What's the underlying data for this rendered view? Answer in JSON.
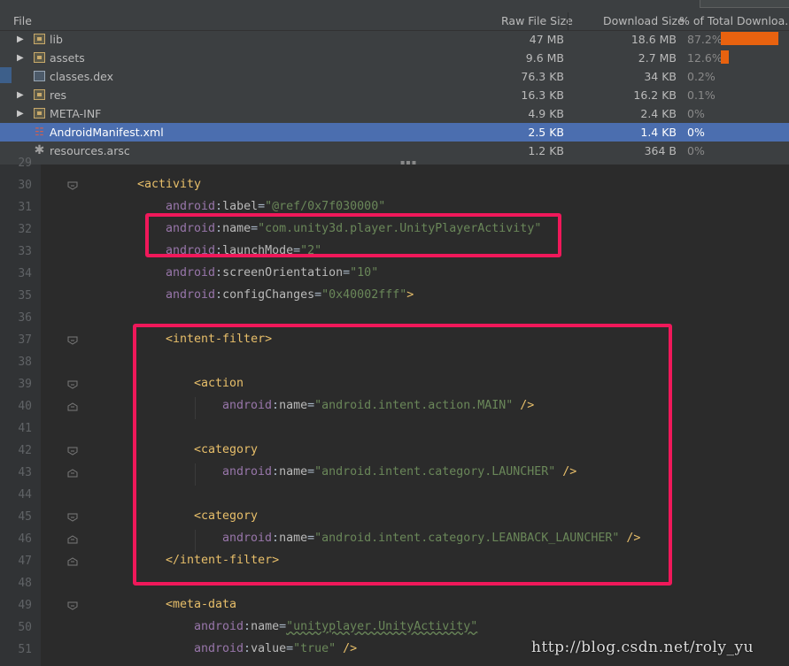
{
  "table": {
    "headers": {
      "file": "File",
      "raw": "Raw File Size",
      "download": "Download Size",
      "percent": "% of Total Downloa..."
    },
    "rows": [
      {
        "name": "lib",
        "raw": "47 MB",
        "download": "18.6 MB",
        "percent": "87.2%",
        "percent_value": 87.2,
        "type": "folder",
        "expandable": true,
        "selected": false
      },
      {
        "name": "assets",
        "raw": "9.6 MB",
        "download": "2.7 MB",
        "percent": "12.6%",
        "percent_value": 12.6,
        "type": "folder",
        "expandable": true,
        "selected": false
      },
      {
        "name": "classes.dex",
        "raw": "76.3 KB",
        "download": "34 KB",
        "percent": "0.2%",
        "percent_value": 0.2,
        "type": "dex-file",
        "expandable": false,
        "selected": false
      },
      {
        "name": "res",
        "raw": "16.3 KB",
        "download": "16.2 KB",
        "percent": "0.1%",
        "percent_value": 0.1,
        "type": "res-folder",
        "expandable": true,
        "selected": false
      },
      {
        "name": "META-INF",
        "raw": "4.9 KB",
        "download": "2.4 KB",
        "percent": "0%",
        "percent_value": 0,
        "type": "folder",
        "expandable": true,
        "selected": false
      },
      {
        "name": "AndroidManifest.xml",
        "raw": "2.5 KB",
        "download": "1.4 KB",
        "percent": "0%",
        "percent_value": 0,
        "type": "xml-file",
        "expandable": false,
        "selected": true
      },
      {
        "name": "resources.arsc",
        "raw": "1.2 KB",
        "download": "364 B",
        "percent": "0%",
        "percent_value": 0,
        "type": "arsc-file",
        "expandable": false,
        "selected": false
      }
    ],
    "bar_color": "#e8620f",
    "selection_color": "#4b6eaf"
  },
  "editor": {
    "line_numbers": [
      "29",
      "30",
      "31",
      "32",
      "33",
      "34",
      "35",
      "36",
      "37",
      "38",
      "39",
      "40",
      "41",
      "42",
      "43",
      "44",
      "45",
      "46",
      "47",
      "48",
      "49",
      "50",
      "51"
    ],
    "lines": [
      [],
      [
        [
          "tag",
          "<activity"
        ]
      ],
      [
        [
          "ns",
          "android"
        ],
        [
          "pun",
          ":"
        ],
        [
          "attr",
          "label"
        ],
        [
          "pun",
          "="
        ],
        [
          "val",
          "\"@ref/0x7f030000\""
        ]
      ],
      [
        [
          "ns",
          "android"
        ],
        [
          "pun",
          ":"
        ],
        [
          "attr",
          "name"
        ],
        [
          "pun",
          "="
        ],
        [
          "val",
          "\"com.unity3d.player.UnityPlayerActivity\""
        ]
      ],
      [
        [
          "ns",
          "android"
        ],
        [
          "pun",
          ":"
        ],
        [
          "attr",
          "launchMode"
        ],
        [
          "pun",
          "="
        ],
        [
          "val",
          "\"2\""
        ]
      ],
      [
        [
          "ns",
          "android"
        ],
        [
          "pun",
          ":"
        ],
        [
          "attr",
          "screenOrientation"
        ],
        [
          "pun",
          "="
        ],
        [
          "val",
          "\"10\""
        ]
      ],
      [
        [
          "ns",
          "android"
        ],
        [
          "pun",
          ":"
        ],
        [
          "attr",
          "configChanges"
        ],
        [
          "pun",
          "="
        ],
        [
          "val",
          "\"0x40002fff\""
        ],
        [
          "tag",
          ">"
        ]
      ],
      [],
      [
        [
          "tag",
          "<intent-filter>"
        ]
      ],
      [],
      [
        [
          "tag",
          "<action"
        ]
      ],
      [
        [
          "ns",
          "android"
        ],
        [
          "pun",
          ":"
        ],
        [
          "attr",
          "name"
        ],
        [
          "pun",
          "="
        ],
        [
          "val",
          "\"android.intent.action.MAIN\""
        ],
        [
          "tag",
          " />"
        ]
      ],
      [],
      [
        [
          "tag",
          "<category"
        ]
      ],
      [
        [
          "ns",
          "android"
        ],
        [
          "pun",
          ":"
        ],
        [
          "attr",
          "name"
        ],
        [
          "pun",
          "="
        ],
        [
          "val",
          "\"android.intent.category.LAUNCHER\""
        ],
        [
          "tag",
          " />"
        ]
      ],
      [],
      [
        [
          "tag",
          "<category"
        ]
      ],
      [
        [
          "ns",
          "android"
        ],
        [
          "pun",
          ":"
        ],
        [
          "attr",
          "name"
        ],
        [
          "pun",
          "="
        ],
        [
          "val",
          "\"android.intent.category.LEANBACK_LAUNCHER\""
        ],
        [
          "tag",
          " />"
        ]
      ],
      [
        [
          "tag",
          "</intent-filter>"
        ]
      ],
      [],
      [
        [
          "tag",
          "<meta-data"
        ]
      ],
      [
        [
          "ns",
          "android"
        ],
        [
          "pun",
          ":"
        ],
        [
          "attr",
          "name"
        ],
        [
          "pun",
          "="
        ],
        [
          "val",
          "\"unityplayer.UnityActivity\""
        ]
      ],
      [
        [
          "ns",
          "android"
        ],
        [
          "pun",
          ":"
        ],
        [
          "attr",
          "value"
        ],
        [
          "pun",
          "="
        ],
        [
          "val",
          "\"true\""
        ],
        [
          "tag",
          " />"
        ]
      ]
    ],
    "colors": {
      "tag": "#e8bf6a",
      "namespace": "#9876aa",
      "attribute": "#bababa",
      "value": "#6a8759",
      "highlight_box": "#f0185a"
    }
  },
  "watermark": "http://blog.csdn.net/roly_yu"
}
